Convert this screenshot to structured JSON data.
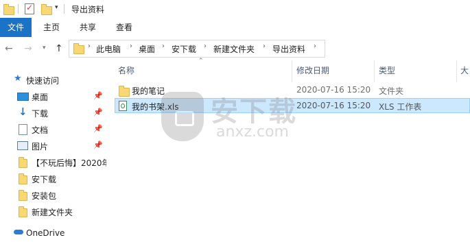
{
  "window": {
    "title": "导出资料"
  },
  "ribbon": {
    "tabs": [
      "文件",
      "主页",
      "共享",
      "查看"
    ]
  },
  "address": {
    "crumbs": [
      "此电脑",
      "桌面",
      "安下载",
      "新建文件夹",
      "导出资料"
    ]
  },
  "sidebar": {
    "quick_access": "快速访问",
    "items": [
      {
        "label": "桌面",
        "icon": "desktop-icon",
        "pinned": true
      },
      {
        "label": "下载",
        "icon": "download-icon",
        "pinned": true
      },
      {
        "label": "文档",
        "icon": "document-icon",
        "pinned": true
      },
      {
        "label": "图片",
        "icon": "picture-icon",
        "pinned": true
      },
      {
        "label": "【不玩后悔】2020年",
        "icon": "folder-icon",
        "pinned": false
      },
      {
        "label": "安下载",
        "icon": "folder-icon",
        "pinned": false
      },
      {
        "label": "安装包",
        "icon": "folder-icon",
        "pinned": false
      },
      {
        "label": "新建文件夹",
        "icon": "folder-icon",
        "pinned": false
      }
    ],
    "onedrive": "OneDrive"
  },
  "columns": {
    "name": "名称",
    "modified": "修改日期",
    "type": "类型",
    "size": "大"
  },
  "files": [
    {
      "name": "我的笔记",
      "modified": "2020-07-16 15:20",
      "type": "文件夹",
      "icon": "folder-icon",
      "selected": false
    },
    {
      "name": "我的书架.xls",
      "modified": "2020-07-16 15:20",
      "type": "XLS 工作表",
      "icon": "excel-file-icon",
      "selected": true
    }
  ],
  "watermark": {
    "text": "安下载",
    "subtext": "anxz.com"
  },
  "colors": {
    "accent": "#1b73c7",
    "selection": "#cce8ff",
    "selection_border": "#99d1ff"
  }
}
